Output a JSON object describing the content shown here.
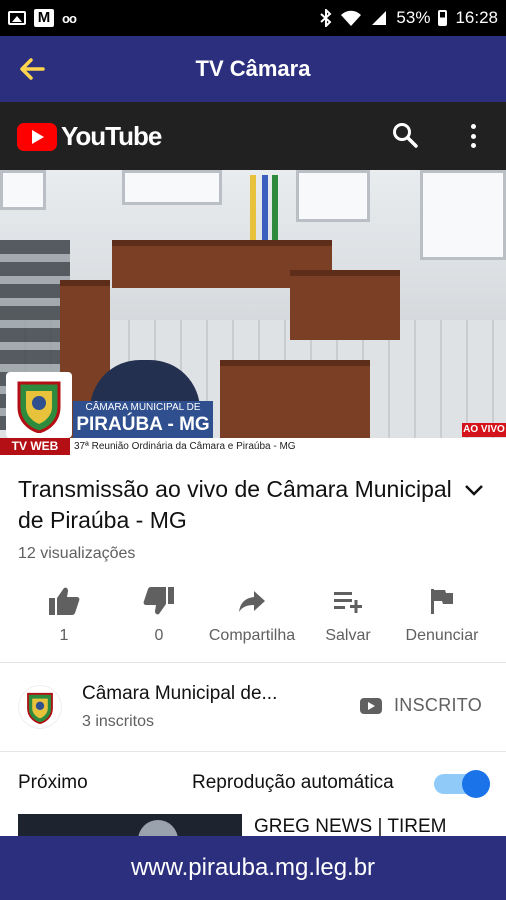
{
  "status_bar": {
    "battery": "53%",
    "time": "16:28",
    "icons": [
      "gallery-icon",
      "m-icon",
      "voicemail-icon",
      "bluetooth-icon",
      "wifi-icon",
      "signal-icon",
      "battery-icon"
    ]
  },
  "app_bar": {
    "title": "TV Câmara"
  },
  "youtube": {
    "brand": "YouTube"
  },
  "video": {
    "plaque_small": "CÂMARA MUNICIPAL DE",
    "plaque_large": "PIRAÚBA - MG",
    "tv_web": "TV WEB",
    "ticker": "37ª Reunião Ordinária da Câmara e Piraúba - MG",
    "live_badge": "AO VIVO"
  },
  "details": {
    "title": "Transmissão ao vivo de Câmara Municipal de Piraúba - MG",
    "views": "12 visualizações",
    "actions": [
      {
        "label": "1",
        "icon": "thumbs-up-icon"
      },
      {
        "label": "0",
        "icon": "thumbs-down-icon"
      },
      {
        "label": "Compartilha",
        "icon": "share-icon"
      },
      {
        "label": "Salvar",
        "icon": "add-to-playlist-icon"
      },
      {
        "label": "Denunciar",
        "icon": "flag-icon"
      }
    ]
  },
  "channel": {
    "name": "Câmara Municipal de...",
    "subscribers": "3 inscritos",
    "subscribed_label": "INSCRITO"
  },
  "up_next": {
    "label": "Próximo",
    "autoplay_label": "Reprodução automática",
    "autoplay_on": true,
    "next_title": "GREG NEWS | TIREM"
  },
  "footer": {
    "url": "www.pirauba.mg.leg.br"
  },
  "colors": {
    "app_bar": "#2b2f7e",
    "youtube_red": "#ff0000",
    "toggle_on": "#1a73e8"
  }
}
